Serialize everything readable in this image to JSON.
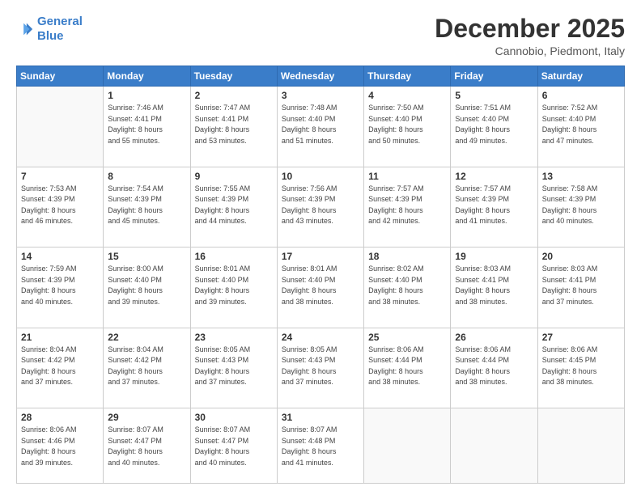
{
  "header": {
    "logo": {
      "line1": "General",
      "line2": "Blue"
    },
    "title": "December 2025",
    "location": "Cannobio, Piedmont, Italy"
  },
  "weekdays": [
    "Sunday",
    "Monday",
    "Tuesday",
    "Wednesday",
    "Thursday",
    "Friday",
    "Saturday"
  ],
  "weeks": [
    [
      {
        "day": "",
        "info": ""
      },
      {
        "day": "1",
        "info": "Sunrise: 7:46 AM\nSunset: 4:41 PM\nDaylight: 8 hours\nand 55 minutes."
      },
      {
        "day": "2",
        "info": "Sunrise: 7:47 AM\nSunset: 4:41 PM\nDaylight: 8 hours\nand 53 minutes."
      },
      {
        "day": "3",
        "info": "Sunrise: 7:48 AM\nSunset: 4:40 PM\nDaylight: 8 hours\nand 51 minutes."
      },
      {
        "day": "4",
        "info": "Sunrise: 7:50 AM\nSunset: 4:40 PM\nDaylight: 8 hours\nand 50 minutes."
      },
      {
        "day": "5",
        "info": "Sunrise: 7:51 AM\nSunset: 4:40 PM\nDaylight: 8 hours\nand 49 minutes."
      },
      {
        "day": "6",
        "info": "Sunrise: 7:52 AM\nSunset: 4:40 PM\nDaylight: 8 hours\nand 47 minutes."
      }
    ],
    [
      {
        "day": "7",
        "info": "Sunrise: 7:53 AM\nSunset: 4:39 PM\nDaylight: 8 hours\nand 46 minutes."
      },
      {
        "day": "8",
        "info": "Sunrise: 7:54 AM\nSunset: 4:39 PM\nDaylight: 8 hours\nand 45 minutes."
      },
      {
        "day": "9",
        "info": "Sunrise: 7:55 AM\nSunset: 4:39 PM\nDaylight: 8 hours\nand 44 minutes."
      },
      {
        "day": "10",
        "info": "Sunrise: 7:56 AM\nSunset: 4:39 PM\nDaylight: 8 hours\nand 43 minutes."
      },
      {
        "day": "11",
        "info": "Sunrise: 7:57 AM\nSunset: 4:39 PM\nDaylight: 8 hours\nand 42 minutes."
      },
      {
        "day": "12",
        "info": "Sunrise: 7:57 AM\nSunset: 4:39 PM\nDaylight: 8 hours\nand 41 minutes."
      },
      {
        "day": "13",
        "info": "Sunrise: 7:58 AM\nSunset: 4:39 PM\nDaylight: 8 hours\nand 40 minutes."
      }
    ],
    [
      {
        "day": "14",
        "info": "Sunrise: 7:59 AM\nSunset: 4:39 PM\nDaylight: 8 hours\nand 40 minutes."
      },
      {
        "day": "15",
        "info": "Sunrise: 8:00 AM\nSunset: 4:40 PM\nDaylight: 8 hours\nand 39 minutes."
      },
      {
        "day": "16",
        "info": "Sunrise: 8:01 AM\nSunset: 4:40 PM\nDaylight: 8 hours\nand 39 minutes."
      },
      {
        "day": "17",
        "info": "Sunrise: 8:01 AM\nSunset: 4:40 PM\nDaylight: 8 hours\nand 38 minutes."
      },
      {
        "day": "18",
        "info": "Sunrise: 8:02 AM\nSunset: 4:40 PM\nDaylight: 8 hours\nand 38 minutes."
      },
      {
        "day": "19",
        "info": "Sunrise: 8:03 AM\nSunset: 4:41 PM\nDaylight: 8 hours\nand 38 minutes."
      },
      {
        "day": "20",
        "info": "Sunrise: 8:03 AM\nSunset: 4:41 PM\nDaylight: 8 hours\nand 37 minutes."
      }
    ],
    [
      {
        "day": "21",
        "info": "Sunrise: 8:04 AM\nSunset: 4:42 PM\nDaylight: 8 hours\nand 37 minutes."
      },
      {
        "day": "22",
        "info": "Sunrise: 8:04 AM\nSunset: 4:42 PM\nDaylight: 8 hours\nand 37 minutes."
      },
      {
        "day": "23",
        "info": "Sunrise: 8:05 AM\nSunset: 4:43 PM\nDaylight: 8 hours\nand 37 minutes."
      },
      {
        "day": "24",
        "info": "Sunrise: 8:05 AM\nSunset: 4:43 PM\nDaylight: 8 hours\nand 37 minutes."
      },
      {
        "day": "25",
        "info": "Sunrise: 8:06 AM\nSunset: 4:44 PM\nDaylight: 8 hours\nand 38 minutes."
      },
      {
        "day": "26",
        "info": "Sunrise: 8:06 AM\nSunset: 4:44 PM\nDaylight: 8 hours\nand 38 minutes."
      },
      {
        "day": "27",
        "info": "Sunrise: 8:06 AM\nSunset: 4:45 PM\nDaylight: 8 hours\nand 38 minutes."
      }
    ],
    [
      {
        "day": "28",
        "info": "Sunrise: 8:06 AM\nSunset: 4:46 PM\nDaylight: 8 hours\nand 39 minutes."
      },
      {
        "day": "29",
        "info": "Sunrise: 8:07 AM\nSunset: 4:47 PM\nDaylight: 8 hours\nand 40 minutes."
      },
      {
        "day": "30",
        "info": "Sunrise: 8:07 AM\nSunset: 4:47 PM\nDaylight: 8 hours\nand 40 minutes."
      },
      {
        "day": "31",
        "info": "Sunrise: 8:07 AM\nSunset: 4:48 PM\nDaylight: 8 hours\nand 41 minutes."
      },
      {
        "day": "",
        "info": ""
      },
      {
        "day": "",
        "info": ""
      },
      {
        "day": "",
        "info": ""
      }
    ]
  ]
}
